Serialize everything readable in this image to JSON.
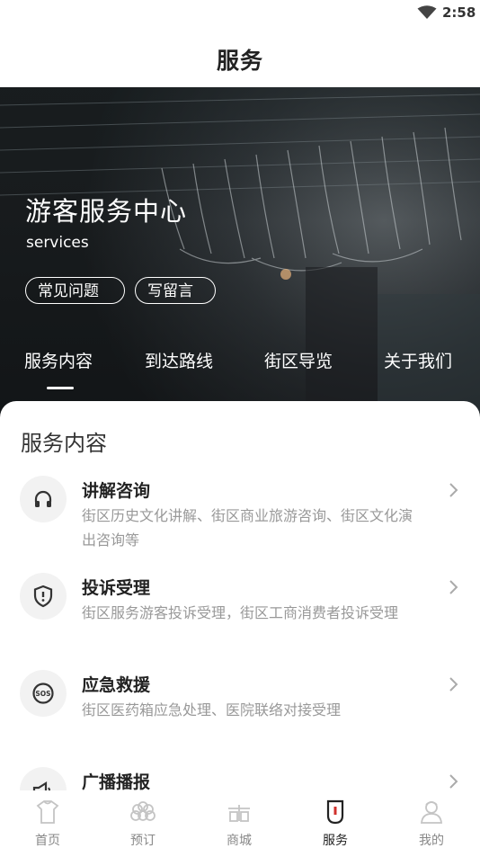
{
  "status": {
    "time": "2:58"
  },
  "header": {
    "title": "服务"
  },
  "hero": {
    "title": "游客服务中心",
    "subtitle": "services",
    "chips": [
      "常见问题",
      "写留言"
    ],
    "tabs": [
      "服务内容",
      "到达路线",
      "街区导览",
      "关于我们"
    ],
    "active_tab": "服务内容"
  },
  "section": {
    "title": "服务内容"
  },
  "services": [
    {
      "icon": "headphones-icon",
      "title": "讲解咨询",
      "desc": "街区历史文化讲解、街区商业旅游咨询、街区文化演出咨询等"
    },
    {
      "icon": "shield-alert-icon",
      "title": "投诉受理",
      "desc": "街区服务游客投诉受理，街区工商消费者投诉受理"
    },
    {
      "icon": "sos-icon",
      "title": "应急救援",
      "desc": "街区医药箱应急处理、医院联络对接受理"
    },
    {
      "icon": "megaphone-icon",
      "title": "广播播报",
      "desc": ""
    }
  ],
  "tabbar": {
    "items": [
      "首页",
      "预订",
      "商城",
      "服务",
      "我的"
    ],
    "active": "服务",
    "accent": "#d0312d"
  }
}
